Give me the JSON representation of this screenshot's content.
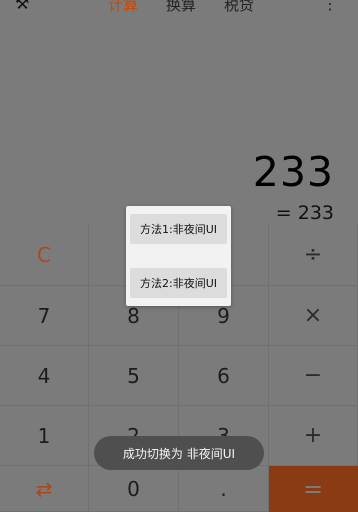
{
  "header": {
    "tabs": [
      "计算",
      "换算",
      "税贷"
    ],
    "active_tab": "计算",
    "tool_icon": "settings-wrench-icon",
    "more_icon": "more-vertical-icon",
    "accent_color": "#c04a10"
  },
  "display": {
    "expression": "233",
    "result": "=  233"
  },
  "keypad": {
    "rows": [
      [
        "C",
        "⌫",
        "%",
        "÷"
      ],
      [
        "7",
        "8",
        "9",
        "×"
      ],
      [
        "4",
        "5",
        "6",
        "−"
      ],
      [
        "1",
        "2",
        "3",
        "+"
      ],
      [
        "⇄",
        "0",
        ".",
        "="
      ]
    ]
  },
  "popup": {
    "option1": "方法1:非夜间UI",
    "option2": "方法2:非夜间UI"
  },
  "toast": {
    "message": "成功切换为 非夜间UI"
  }
}
